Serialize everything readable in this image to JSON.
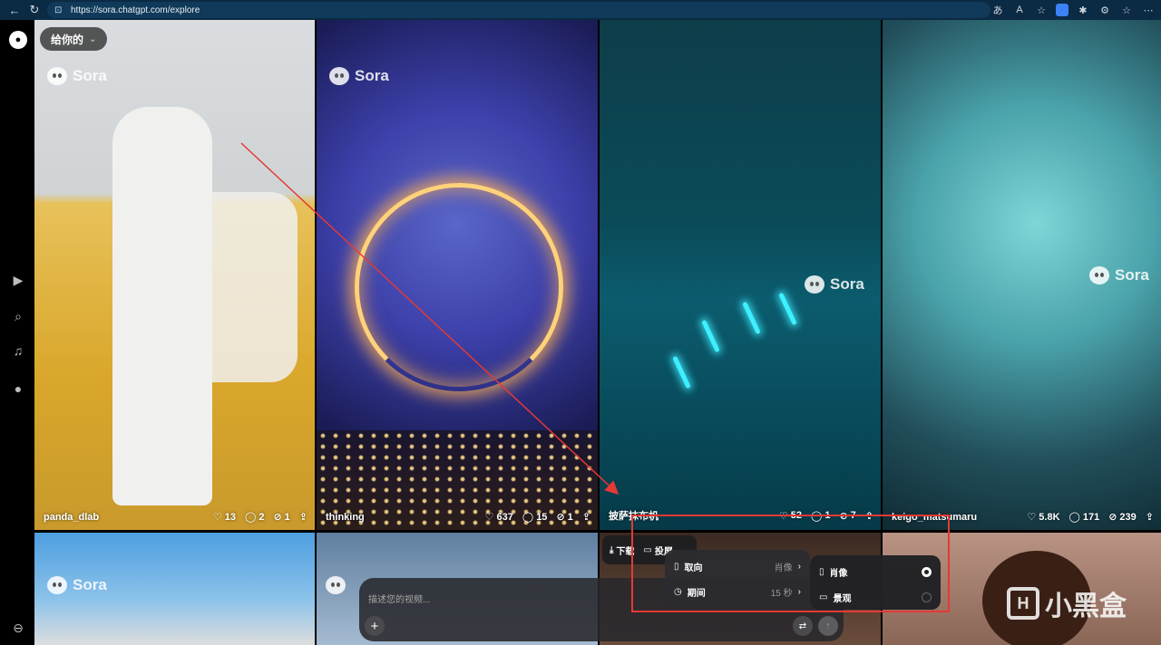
{
  "browser": {
    "url": "https://sora.chatgpt.com/explore",
    "back_icon": "←",
    "refresh_icon": "↻",
    "lock_icon": "⊡"
  },
  "filter": {
    "label": "给你的",
    "caret": "⌄"
  },
  "watermark_text": "Sora",
  "tiles": [
    {
      "user": "panda_dlab",
      "likes": "13",
      "comments": "2",
      "remixes": "1"
    },
    {
      "user": "thinking",
      "likes": "637",
      "comments": "15",
      "remixes": "1"
    },
    {
      "user": "披萨抹布机",
      "likes": "52",
      "comments": "1",
      "remixes": "7"
    },
    {
      "user": "keigo_matsumaru",
      "likes": "5.8K",
      "comments": "171",
      "remixes": "239"
    }
  ],
  "composer": {
    "placeholder": "描述您的视频..."
  },
  "actions": {
    "download": "下载",
    "cast": "投屏"
  },
  "menu": {
    "orientation_label": "取向",
    "orientation_value": "肖像",
    "duration_label": "期间",
    "duration_value": "15 秒"
  },
  "submenu": {
    "portrait": "肖像",
    "landscape": "景观",
    "selected": "portrait"
  },
  "brand_watermark": "小黑盒",
  "colors": {
    "annotation": "#e53935",
    "chrome": "#0b2a43"
  }
}
